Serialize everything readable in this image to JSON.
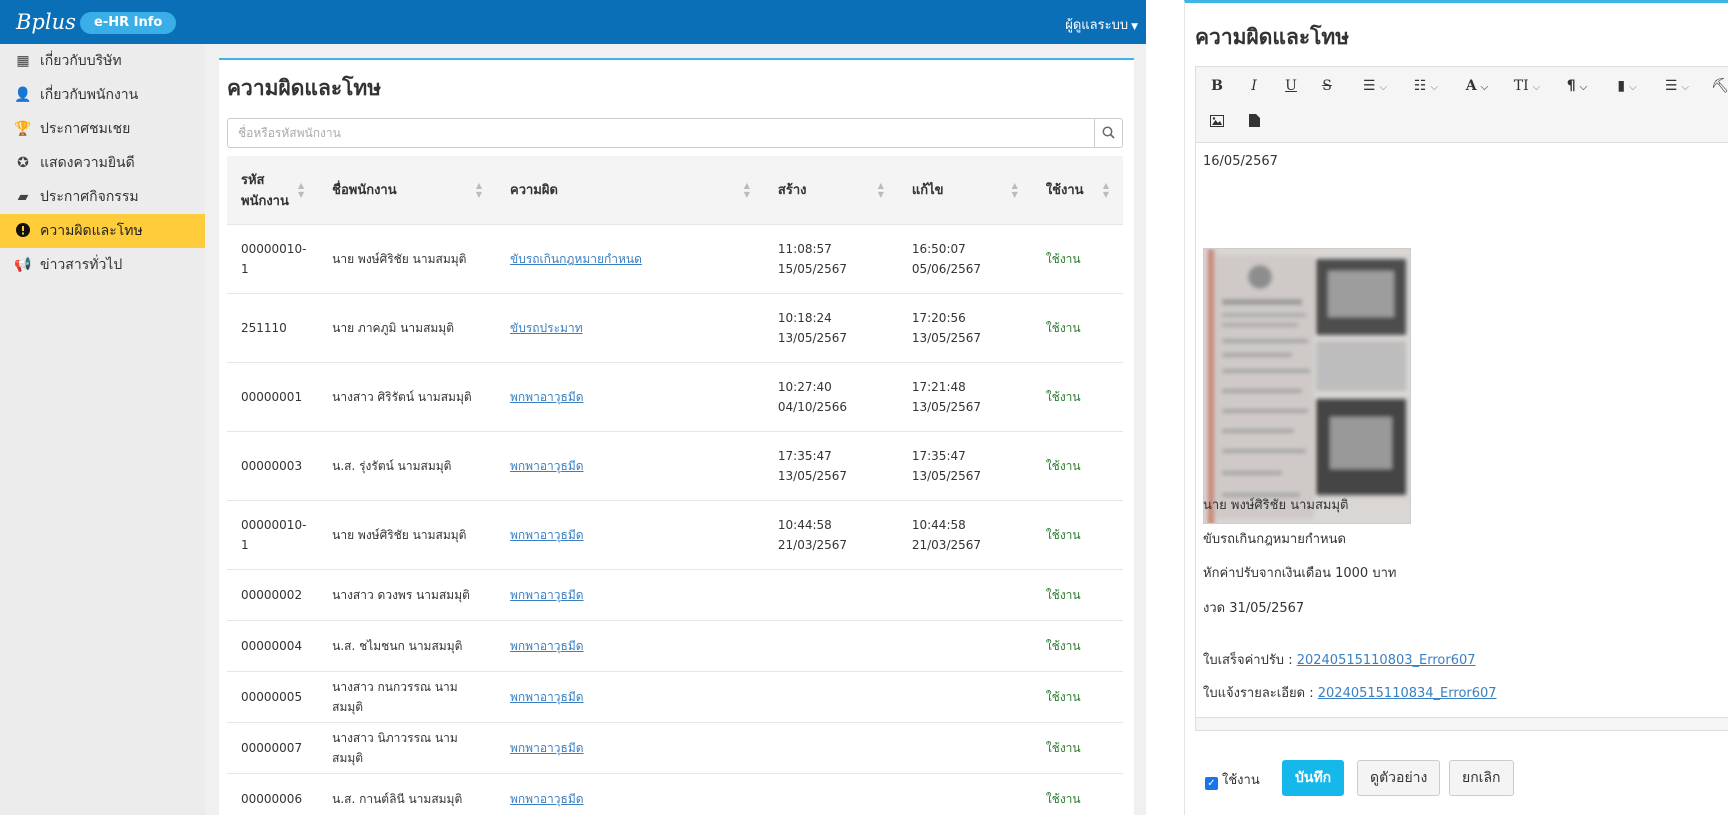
{
  "header": {
    "brand": "Bplus",
    "module": "e-HR Info",
    "user_menu": "ผู้ดูแลระบบ"
  },
  "sidebar": {
    "items": [
      {
        "label": "เกี่ยวกับบริษัท",
        "icon": "building-icon",
        "active": false
      },
      {
        "label": "เกี่ยวกับพนักงาน",
        "icon": "user-icon",
        "active": false
      },
      {
        "label": "ประกาศชมเชย",
        "icon": "trophy-icon",
        "active": false
      },
      {
        "label": "แสดงความยินดี",
        "icon": "award-icon",
        "active": false
      },
      {
        "label": "ประกาศกิจกรรม",
        "icon": "comment-icon",
        "active": false
      },
      {
        "label": "ความผิดและโทษ",
        "icon": "exclamation-circle-icon",
        "active": true
      },
      {
        "label": "ข่าวสารทั่วไป",
        "icon": "megaphone-icon",
        "active": false
      }
    ]
  },
  "main": {
    "title": "ความผิดและโทษ",
    "search_placeholder": "ชื่อหรือรหัสพนักงาน",
    "columns": [
      "รหัสพนักงาน",
      "ชื่อพนักงาน",
      "ความผิด",
      "สร้าง",
      "แก้ไข",
      "ใช้งาน"
    ],
    "rows": [
      {
        "code": "00000010-1",
        "name": "นาย พงษ์ศิริชัย นามสมมุติ",
        "offense": "ขับรถเกินกฎหมายกำหนด",
        "created_time": "11:08:57",
        "created_date": "15/05/2567",
        "edited_time": "16:50:07",
        "edited_date": "05/06/2567",
        "status": "ใช้งาน"
      },
      {
        "code": "251110",
        "name": "นาย ภาคภูมิ นามสมมุติ",
        "offense": "ขับรถประมาท",
        "created_time": "10:18:24",
        "created_date": "13/05/2567",
        "edited_time": "17:20:56",
        "edited_date": "13/05/2567",
        "status": "ใช้งาน"
      },
      {
        "code": "00000001",
        "name": "นางสาว ศิริรัตน์ นามสมมุติ",
        "offense": "พกพาอาวุธมีด",
        "created_time": "10:27:40",
        "created_date": "04/10/2566",
        "edited_time": "17:21:48",
        "edited_date": "13/05/2567",
        "status": "ใช้งาน"
      },
      {
        "code": "00000003",
        "name": "น.ส. รุ่งรัตน์ นามสมมุติ",
        "offense": "พกพาอาวุธมีด",
        "created_time": "17:35:47",
        "created_date": "13/05/2567",
        "edited_time": "17:35:47",
        "edited_date": "13/05/2567",
        "status": "ใช้งาน"
      },
      {
        "code": "00000010-1",
        "name": "นาย พงษ์ศิริชัย นามสมมุติ",
        "offense": "พกพาอาวุธมีด",
        "created_time": "10:44:58",
        "created_date": "21/03/2567",
        "edited_time": "10:44:58",
        "edited_date": "21/03/2567",
        "status": "ใช้งาน"
      },
      {
        "code": "00000002",
        "name": "นางสาว ดวงพร นามสมมุติ",
        "offense": "พกพาอาวุธมีด",
        "created_time": "",
        "created_date": "",
        "edited_time": "",
        "edited_date": "",
        "status": "ใช้งาน"
      },
      {
        "code": "00000004",
        "name": "น.ส. ชไมชนก นามสมมุติ",
        "offense": "พกพาอาวุธมีด",
        "created_time": "",
        "created_date": "",
        "edited_time": "",
        "edited_date": "",
        "status": "ใช้งาน"
      },
      {
        "code": "00000005",
        "name": "นางสาว กนกวรรณ นามสมมุติ",
        "offense": "พกพาอาวุธมีด",
        "created_time": "",
        "created_date": "",
        "edited_time": "",
        "edited_date": "",
        "status": "ใช้งาน"
      },
      {
        "code": "00000007",
        "name": "นางสาว นิภาวรรณ นามสมมุติ",
        "offense": "พกพาอาวุธมีด",
        "created_time": "",
        "created_date": "",
        "edited_time": "",
        "edited_date": "",
        "status": "ใช้งาน"
      },
      {
        "code": "00000006",
        "name": "น.ส. กานต์ลินี นามสมมุติ",
        "offense": "พกพาอาวุธมีด",
        "created_time": "",
        "created_date": "",
        "edited_time": "",
        "edited_date": "",
        "status": "ใช้งาน"
      }
    ]
  },
  "panel": {
    "title": "ความผิดและโทษ",
    "toolbar": [
      "bold-icon",
      "italic-icon",
      "underline-icon",
      "strikethrough-icon",
      "bullet-list-icon",
      "numbered-list-icon",
      "font-color-icon",
      "font-size-icon",
      "paragraph-icon",
      "style-icon",
      "align-icon",
      "paint-format-icon",
      "image-icon",
      "file-icon"
    ],
    "content": {
      "date": "16/05/2567",
      "employee": "นาย พงษ์ศิริชัย นามสมมุติ",
      "offense": "ขับรถเกินกฎหมายกำหนด",
      "penalty": "หักค่าปรับจากเงินเดือน 1000 บาท",
      "due": "งวด 31/05/2567",
      "receipt_label": "ใบเสร็จค่าปรับ :",
      "receipt_link": "20240515110803_Error607",
      "notice_label": "ใบแจ้งรายละเอียด :",
      "notice_link": "20240515110834_Error607"
    },
    "active_label": "ใช้งาน",
    "active_checked": true,
    "save_label": "บันทึก",
    "preview_label": "ดูตัวอย่าง",
    "cancel_label": "ยกเลิก"
  },
  "colors": {
    "topbar": "#0b6fb8",
    "accent": "#3fb4e6",
    "active_nav": "#ffcd3c",
    "link": "#3a7fc1",
    "status": "#2e7d32",
    "save_button": "#16b8ec"
  }
}
